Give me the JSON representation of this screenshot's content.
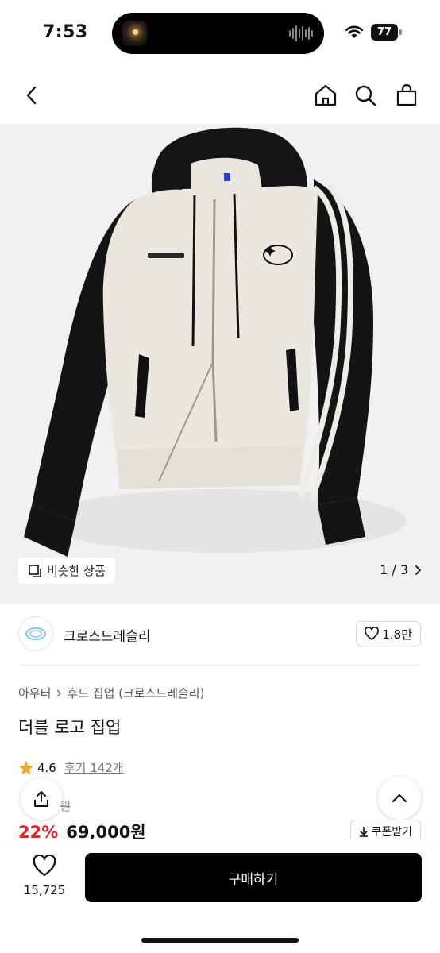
{
  "status_bar": {
    "time": "7:53",
    "battery": "77"
  },
  "nav": {
    "back_icon": "chevron-left-icon",
    "home_icon": "home-icon",
    "search_icon": "search-icon",
    "cart_icon": "shopping-bag-icon"
  },
  "gallery": {
    "similar_label": "비슷한 상품",
    "pager": "1 / 3"
  },
  "brand": {
    "name": "크로스드레슬리",
    "likes": "1.8만"
  },
  "breadcrumb": {
    "level1": "아우터",
    "level2": "후드 집업 (크로스드레슬리)"
  },
  "product": {
    "title": "더블 로고 집업",
    "rating": "4.6",
    "reviews": "후기 142개",
    "original_price": "0원",
    "discount": "22%",
    "price": "69,000원"
  },
  "coupon_label": "쿠폰받기",
  "bottom": {
    "wish_count": "15,725",
    "buy_label": "구매하기"
  },
  "colors": {
    "discount": "#e0262b",
    "buy_button": "#000000",
    "star": "#f5a623"
  }
}
